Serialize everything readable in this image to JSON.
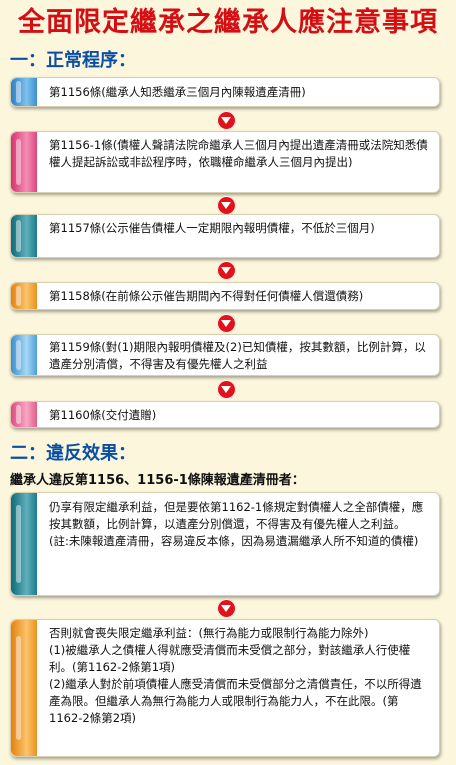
{
  "title": "全面限定繼承之繼承人應注意事項",
  "section1": {
    "heading": "一：正常程序：",
    "steps": [
      {
        "text": "第1156條(繼承人知悉繼承三個月內陳報遺產清冊)"
      },
      {
        "text": "第1156-1條(債權人聲請法院命繼承人三個月內提出遺產清冊或法院知悉債權人提起訴訟或非訟程序時，依職權命繼承人三個月內提出)"
      },
      {
        "text": "第1157條(公示催告債權人一定期限內報明債權，不低於三個月)"
      },
      {
        "text": "第1158條(在前條公示催告期間內不得對任何債權人償還債務)"
      },
      {
        "text": "第1159條(對(1)期限內報明債權及(2)已知債權，按其數額，比例計算，以遺產分別清償，不得害及有優先權人之利益"
      },
      {
        "text": "第1160條(交付遺贈)"
      }
    ]
  },
  "section2": {
    "heading": "二：違反效果：",
    "subheading": "繼承人違反第1156、1156-1條陳報遺產清冊者：",
    "box1": {
      "p1": "仍享有限定繼承利益，但是要依第1162-1條規定對債權人之全部債權，應按其數額，比例計算，以遺產分別償還，不得害及有優先權人之利益。",
      "p2": "(註:未陳報遺產清冊，容易違反本條，因為易遺漏繼承人所不知道的債權)"
    },
    "box2": {
      "p1": "否則就會喪失限定繼承利益：(無行為能力或限制行為能力除外)",
      "p2": "(1)被繼承人之債權人得就應受清償而未受償之部分，對該繼承人行使權利。(第1162-2條第1項)",
      "p3": "(2)繼承人對於前項債權人應受清償而未受償部分之清償責任，不以所得遺產為限。但繼承人為無行為能力人或限制行為能力人，不在此限。(第1162-2條第2項)"
    }
  },
  "colors": {
    "title": "#d40f14",
    "heading": "#0b4fa4",
    "arrow": "#e2121b",
    "background": "#fbf6dc"
  }
}
